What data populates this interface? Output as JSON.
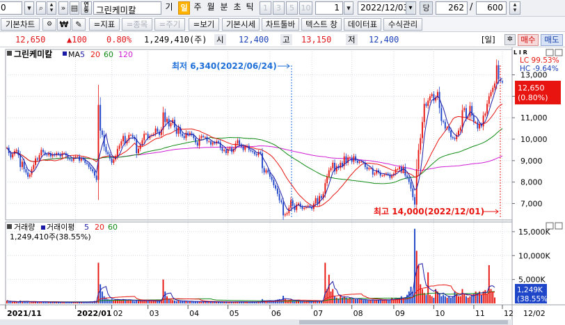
{
  "toolbar": {
    "code_value": "0",
    "stock_name": "그린케미칼",
    "periods": [
      "기",
      "일",
      "주",
      "월",
      "분",
      "초",
      "틱"
    ],
    "active_period": "일",
    "intervals": [
      "1",
      "3",
      "5",
      "10"
    ],
    "count_value": "1",
    "date_value": "2022/12/03",
    "dang_label": "당",
    "view_count": "262",
    "total_count": "600"
  },
  "toolbar2": {
    "buttons": [
      "기본차트",
      "=지표",
      "=종목",
      "=주기",
      "=보기",
      "기본시세",
      "차트툴바",
      "텍스트 창",
      "데이터표",
      "수식관리"
    ],
    "disabled": [
      "=종목",
      "=주기"
    ]
  },
  "quote": {
    "price": "12,650",
    "change": "▲100",
    "change_pct": "0.80%",
    "volume": "1,249,410(주)",
    "open_label": "시",
    "open": "12,400",
    "high_label": "고",
    "high": "13,150",
    "low_label": "저",
    "low": "12,400",
    "day_label": "[일]",
    "buy_label": "매수",
    "sell_label": "매도"
  },
  "price_panel": {
    "title": "그린케미칼",
    "indicator_label": "MA",
    "ma_periods": [
      "5",
      "20",
      "60",
      "120"
    ],
    "ma_colors": [
      "#1a1aa6",
      "#e8140f",
      "#0e8a12",
      "#d01ad4"
    ],
    "lc_label": "LC 99.53%",
    "hc_label": "HC -9.64%",
    "current_price": "12,650",
    "current_pct": "(0.80%)",
    "low_annotation": "최저 6,340(2022/06/24)",
    "high_annotation": "최고 14,000(2022/12/01)",
    "flags": "L I R"
  },
  "volume_panel": {
    "title": "거래량",
    "avg_label": "거래이평",
    "avg_periods": [
      "5",
      "20",
      "60"
    ],
    "avg_colors": [
      "#1a1aa6",
      "#e8140f",
      "#0e8a12"
    ],
    "volume_text": "1,249,410주(38.55%)",
    "current_vol": "1,249K",
    "current_vol_pct": "(38.55%)"
  },
  "x_axis": {
    "labels": [
      "2021/11",
      "2022/01",
      "02",
      "03",
      "04",
      "05",
      "06",
      "07",
      "08",
      "09",
      "10",
      "11",
      "12"
    ],
    "end_label": "12/02"
  },
  "chart_data": {
    "type": "line",
    "price_axis": {
      "ticks": [
        "13,000",
        "12,000",
        "11,000",
        "10,000",
        "9,000",
        "8,000",
        "7,000"
      ],
      "ylim": [
        6300,
        13700
      ]
    },
    "volume_axis": {
      "ticks": [
        "15,000K",
        "10,000K",
        "5,000K"
      ],
      "ylim": [
        0,
        16000
      ]
    },
    "close": [
      9600,
      9350,
      9150,
      9300,
      9450,
      9500,
      9250,
      8700,
      8950,
      8600,
      8450,
      8250,
      8350,
      8600,
      8800,
      9100,
      9050,
      9250,
      9500,
      9400,
      9300,
      9250,
      9350,
      9200,
      9300,
      9250,
      9350,
      9300,
      9200,
      9350,
      9350,
      9250,
      9100,
      9050,
      9000,
      9150,
      9200,
      9200,
      9000,
      9100,
      9050,
      8900,
      8850,
      8700,
      8600,
      8500,
      8300,
      8100,
      11600,
      10400,
      10200,
      9650,
      9400,
      9300,
      9100,
      8900,
      9050,
      9200,
      9550,
      9700,
      9900,
      10150,
      9800,
      9950,
      10200,
      10200,
      10100,
      10000,
      9350,
      9550,
      9750,
      9950,
      10250,
      10250,
      10050,
      10150,
      10200,
      10250,
      10500,
      10350,
      10200,
      10450,
      11250,
      10800,
      10950,
      10600,
      10750,
      10900,
      10550,
      10250,
      10550,
      10250,
      10150,
      10050,
      10300,
      10200,
      10300,
      10200,
      10050,
      9850,
      9700,
      10050,
      10150,
      10100,
      10100,
      9900,
      9900,
      9750,
      9850,
      9800,
      9900,
      9850,
      9600,
      9450,
      9500,
      9350,
      9550,
      9600,
      9400,
      9550,
      9800,
      9950,
      9750,
      9650,
      9500,
      9650,
      9700,
      9500,
      9450,
      9400,
      9300,
      9250,
      9400,
      9350,
      8650,
      8450,
      8550,
      8450,
      8250,
      8100,
      7850,
      7700,
      7450,
      7150,
      7050,
      6450,
      6500,
      6550,
      6800,
      7150,
      6900,
      6700,
      6950,
      7000,
      6850,
      6750,
      6800,
      6850,
      6900,
      6850,
      6750,
      7000,
      7250,
      7000,
      7350,
      7250,
      7450,
      7950,
      8250,
      8550,
      8650,
      8900,
      8500,
      8750,
      8650,
      8900,
      8750,
      9200,
      8900,
      9150,
      9150,
      8950,
      9200,
      9000,
      8900,
      8950,
      8950,
      8900,
      8700,
      8600,
      8650,
      8650,
      8350,
      8400,
      8550,
      8450,
      8300,
      8300,
      8350,
      8400,
      8350,
      8200,
      8300,
      8400,
      8600,
      8600,
      8700,
      8500,
      8700,
      8300,
      8200,
      8000,
      7700,
      7300,
      6950,
      8600,
      9500,
      10050,
      10800,
      11650,
      11550,
      11800,
      12000,
      12100,
      11800,
      11950,
      12200,
      11450,
      10850,
      10800,
      10500,
      10550,
      10400,
      10100,
      10050,
      10000,
      10200,
      10400,
      10550,
      11350,
      11450,
      11000,
      11050,
      11550,
      11100,
      10800,
      10800,
      10500,
      10700,
      10600,
      11100,
      11200,
      11650,
      12000,
      12200,
      12400,
      12600,
      13450,
      12800,
      12700,
      12650
    ],
    "volume": [
      600,
      350,
      400,
      300,
      350,
      300,
      250,
      600,
      400,
      500,
      350,
      300,
      250,
      300,
      350,
      400,
      300,
      300,
      400,
      350,
      300,
      250,
      250,
      300,
      250,
      300,
      250,
      250,
      300,
      250,
      300,
      250,
      250,
      300,
      250,
      250,
      300,
      300,
      250,
      300,
      250,
      350,
      300,
      350,
      400,
      350,
      500,
      450,
      8500,
      4000,
      2500,
      1500,
      1200,
      900,
      800,
      900,
      700,
      800,
      900,
      700,
      700,
      900,
      700,
      700,
      800,
      700,
      600,
      500,
      700,
      500,
      500,
      600,
      700,
      600,
      500,
      600,
      500,
      500,
      600,
      500,
      500,
      600,
      5000,
      2500,
      1500,
      1000,
      800,
      700,
      600,
      500,
      600,
      500,
      500,
      500,
      500,
      400,
      500,
      400,
      400,
      400,
      400,
      400,
      400,
      350,
      350,
      350,
      350,
      350,
      350,
      300,
      350,
      300,
      300,
      300,
      300,
      300,
      350,
      300,
      300,
      300,
      400,
      400,
      350,
      300,
      300,
      350,
      300,
      300,
      300,
      350,
      300,
      300,
      350,
      300,
      900,
      600,
      500,
      500,
      500,
      600,
      600,
      700,
      800,
      900,
      800,
      1600,
      900,
      600,
      700,
      800,
      600,
      500,
      600,
      500,
      400,
      400,
      400,
      400,
      400,
      400,
      400,
      450,
      600,
      500,
      600,
      500,
      700,
      8500,
      3000,
      6000,
      2500,
      3000,
      1500,
      1200,
      1000,
      1800,
      1200,
      1500,
      1200,
      1000,
      1200,
      1000,
      900,
      900,
      900,
      800,
      800,
      700,
      800,
      700,
      700,
      700,
      800,
      700,
      700,
      700,
      800,
      700,
      700,
      800,
      700,
      800,
      1200,
      800,
      1000,
      900,
      1000,
      1500,
      1200,
      1300,
      1800,
      2500,
      3500,
      2500,
      15600,
      11000,
      8000,
      4000,
      3000,
      2200,
      1800,
      6500,
      1800,
      1500,
      1200,
      3000,
      2500,
      2000,
      1500,
      1800,
      1500,
      1200,
      1500,
      1200,
      1500,
      2500,
      2000,
      1500,
      1500,
      3000,
      2000,
      1500,
      1200,
      1500,
      1800,
      2000,
      2500,
      2000,
      2500,
      1800,
      2500,
      2800,
      2000,
      8000,
      3000,
      2500,
      1249
    ]
  }
}
